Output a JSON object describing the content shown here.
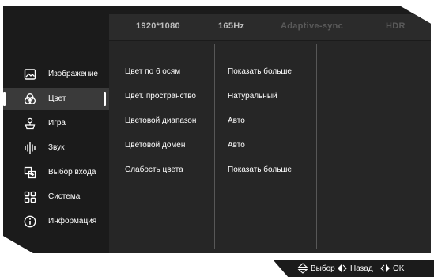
{
  "topbar": {
    "resolution": "1920*1080",
    "refresh_rate": "165Hz",
    "adaptive_sync": "Adaptive-sync",
    "hdr": "HDR"
  },
  "menu": [
    {
      "label": "Изображение",
      "icon": "image-icon"
    },
    {
      "label": "Цвет",
      "icon": "color-icon"
    },
    {
      "label": "Игра",
      "icon": "game-icon"
    },
    {
      "label": "Звук",
      "icon": "sound-icon"
    },
    {
      "label": "Выбор входа",
      "icon": "input-icon"
    },
    {
      "label": "Система",
      "icon": "system-icon"
    },
    {
      "label": "Информация",
      "icon": "info-icon"
    }
  ],
  "selected_menu": "Цвет",
  "settings": [
    {
      "name": "Цвет по 6 осям",
      "value": "Показать больше"
    },
    {
      "name": "Цвет. пространство",
      "value": "Натуральный"
    },
    {
      "name": "Цветовой диапазон",
      "value": "Авто"
    },
    {
      "name": "Цветовой домен",
      "value": "Авто"
    },
    {
      "name": "Слабость цвета",
      "value": "Показать больше"
    }
  ],
  "footer": {
    "select_label": "Выбор",
    "back_label": "Назад",
    "ok_label": "OK"
  }
}
